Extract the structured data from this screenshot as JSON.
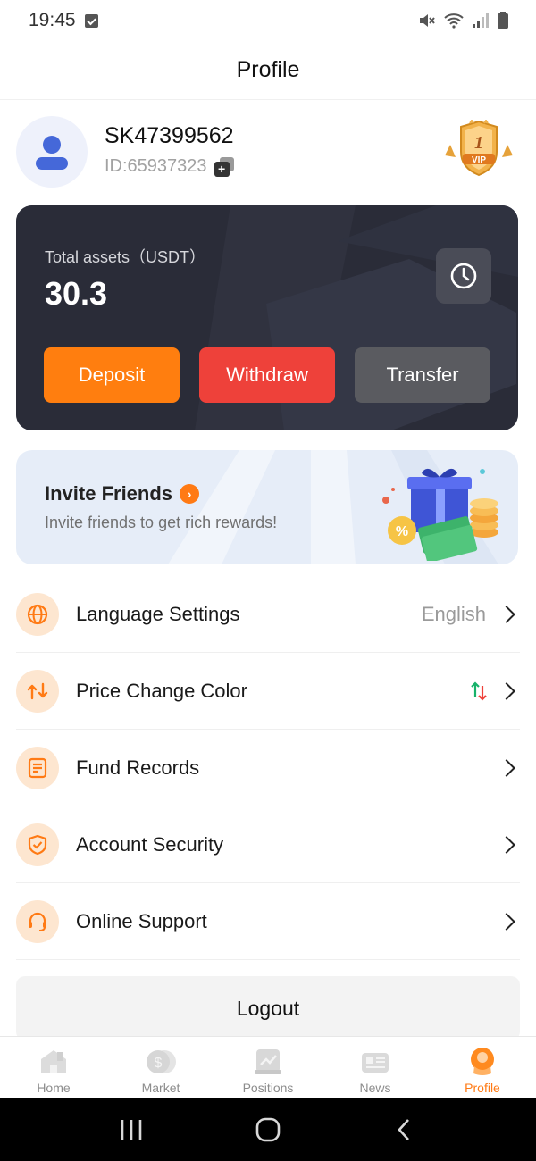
{
  "status_bar": {
    "time": "19:45"
  },
  "header": {
    "title": "Profile"
  },
  "user": {
    "username": "SK47399562",
    "id_text": "ID:65937323",
    "vip_level": "1",
    "vip_label": "VIP"
  },
  "assets": {
    "label": "Total assets（USDT）",
    "value": "30.3",
    "buttons": {
      "deposit": "Deposit",
      "withdraw": "Withdraw",
      "transfer": "Transfer"
    }
  },
  "invite": {
    "title": "Invite Friends",
    "description": "Invite friends to get rich rewards!"
  },
  "menu": [
    {
      "label": "Language Settings",
      "value": "English",
      "icon": "globe-icon"
    },
    {
      "label": "Price Change Color",
      "value": "",
      "icon": "price-change-icon"
    },
    {
      "label": "Fund Records",
      "value": "",
      "icon": "document-icon"
    },
    {
      "label": "Account Security",
      "value": "",
      "icon": "shield-check-icon"
    },
    {
      "label": "Online Support",
      "value": "",
      "icon": "headset-icon"
    }
  ],
  "logout_label": "Logout",
  "tabs": [
    {
      "label": "Home",
      "icon": "home-icon",
      "active": false
    },
    {
      "label": "Market",
      "icon": "market-icon",
      "active": false
    },
    {
      "label": "Positions",
      "icon": "positions-icon",
      "active": false
    },
    {
      "label": "News",
      "icon": "news-icon",
      "active": false
    },
    {
      "label": "Profile",
      "icon": "profile-icon",
      "active": true
    }
  ],
  "colors": {
    "accent": "#ff7a14",
    "deposit": "#ff7e0f",
    "withdraw": "#ee413a",
    "transfer": "#5a5b60",
    "card": "#2a2c38"
  }
}
